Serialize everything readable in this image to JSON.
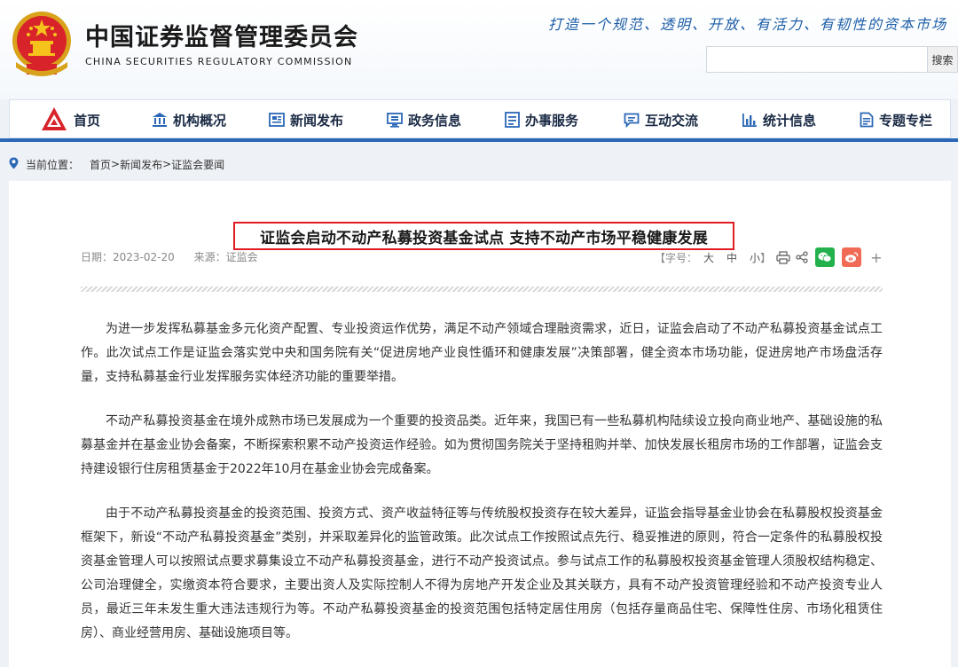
{
  "header": {
    "org_name_cn": "中国证券监督管理委员会",
    "org_name_en": "CHINA SECURITIES REGULATORY COMMISSION",
    "slogan": "打造一个规范、透明、开放、有活力、有韧性的资本市场",
    "search": {
      "placeholder": "",
      "button_label": "搜索"
    }
  },
  "nav": {
    "items": [
      {
        "label": "首页",
        "icon": "csrc-logo-icon"
      },
      {
        "label": "机构概况",
        "icon": "institution-icon"
      },
      {
        "label": "新闻发布",
        "icon": "news-icon"
      },
      {
        "label": "政务信息",
        "icon": "monitor-icon"
      },
      {
        "label": "办事服务",
        "icon": "service-list-icon"
      },
      {
        "label": "互动交流",
        "icon": "chat-icon"
      },
      {
        "label": "统计信息",
        "icon": "bar-chart-icon"
      },
      {
        "label": "专题专栏",
        "icon": "document-icon"
      }
    ],
    "accent_color": "#2b67b6"
  },
  "breadcrumb": {
    "label": "当前位置：",
    "items": [
      "首页",
      "新闻发布",
      "证监会要闻"
    ],
    "separator": ">"
  },
  "article": {
    "title": "证监会启动不动产私募投资基金试点 支持不动产市场平稳健康发展",
    "date_label": "日期：",
    "date": "2023-02-20",
    "source_label": "来源：",
    "source": "证监会",
    "font_size_label": "【字号：",
    "font_sizes": [
      "大",
      "中",
      "小"
    ],
    "font_size_close": "】",
    "share_plus": "+",
    "paragraphs": [
      "为进一步发挥私募基金多元化资产配置、专业投资运作优势，满足不动产领域合理融资需求，近日，证监会启动了不动产私募投资基金试点工作。此次试点工作是证监会落实党中央和国务院有关“促进房地产业良性循环和健康发展”决策部署，健全资本市场功能，促进房地产市场盘活存量，支持私募基金行业发挥服务实体经济功能的重要举措。",
      "不动产私募投资基金在境外成熟市场已发展成为一个重要的投资品类。近年来，我国已有一些私募机构陆续设立投向商业地产、基础设施的私募基金并在基金业协会备案，不断探索积累不动产投资运作经验。如为贯彻国务院关于坚持租购并举、加快发展长租房市场的工作部署，证监会支持建设银行住房租赁基金于2022年10月在基金业协会完成备案。",
      "由于不动产私募投资基金的投资范围、投资方式、资产收益特征等与传统股权投资存在较大差异，证监会指导基金业协会在私募股权投资基金框架下，新设“不动产私募投资基金”类别，并采取差异化的监管政策。此次试点工作按照试点先行、稳妥推进的原则，符合一定条件的私募股权投资基金管理人可以按照试点要求募集设立不动产私募投资基金，进行不动产投资试点。参与试点工作的私募股权投资基金管理人须股权结构稳定、公司治理健全，实缴资本符合要求，主要出资人及实际控制人不得为房地产开发企业及其关联方，具有不动产投资管理经验和不动产投资专业人员，最近三年未发生重大违法违规行为等。不动产私募投资基金的投资范围包括特定居住用房（包括存量商品住宅、保障性住房、市场化租赁住房）、商业经营用房、基础设施项目等。"
    ],
    "highlight_color": "#e11b22"
  }
}
